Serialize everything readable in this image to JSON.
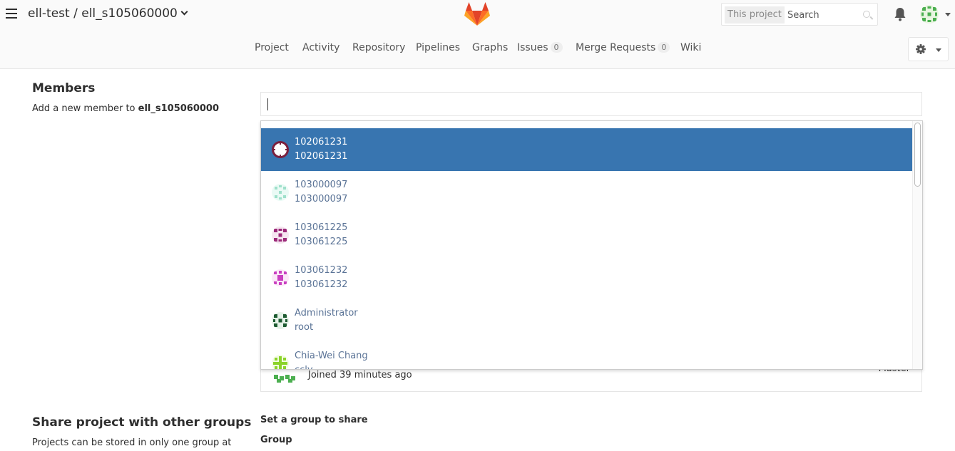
{
  "header": {
    "group": "ell-test",
    "separator": " / ",
    "project": "ell_s105060000",
    "search_scope": "This project",
    "search_placeholder": "Search"
  },
  "nav": {
    "items": [
      {
        "label": "Project"
      },
      {
        "label": "Activity"
      },
      {
        "label": "Repository"
      },
      {
        "label": "Pipelines"
      },
      {
        "label": "Graphs"
      },
      {
        "label": "Issues",
        "count": "0"
      },
      {
        "label": "Merge Requests",
        "count": "0"
      },
      {
        "label": "Wiki"
      }
    ]
  },
  "members": {
    "title": "Members",
    "description_prefix": "Add a new member to ",
    "description_project": "ell_s105060000",
    "search_value": "",
    "dropdown": [
      {
        "name": "102061231",
        "username": "102061231",
        "selected": true
      },
      {
        "name": "103000097",
        "username": "103000097",
        "selected": false
      },
      {
        "name": "103061225",
        "username": "103061225",
        "selected": false
      },
      {
        "name": "103061232",
        "username": "103061232",
        "selected": false
      },
      {
        "name": "Administrator",
        "username": "root",
        "selected": false
      },
      {
        "name": "Chia-Wei Chang",
        "username": "ccly",
        "selected": false
      }
    ],
    "existing_member": {
      "joined": "Joined 39 minutes ago",
      "access": "Master"
    }
  },
  "share": {
    "title": "Share project with other groups",
    "description": "Projects can be stored in only one group at",
    "form_title": "Set a group to share",
    "group_label": "Group"
  },
  "colors": {
    "accent": "#3875b0",
    "link": "#5a7396",
    "logo_orange": "#e24329",
    "logo_light": "#fca326"
  }
}
